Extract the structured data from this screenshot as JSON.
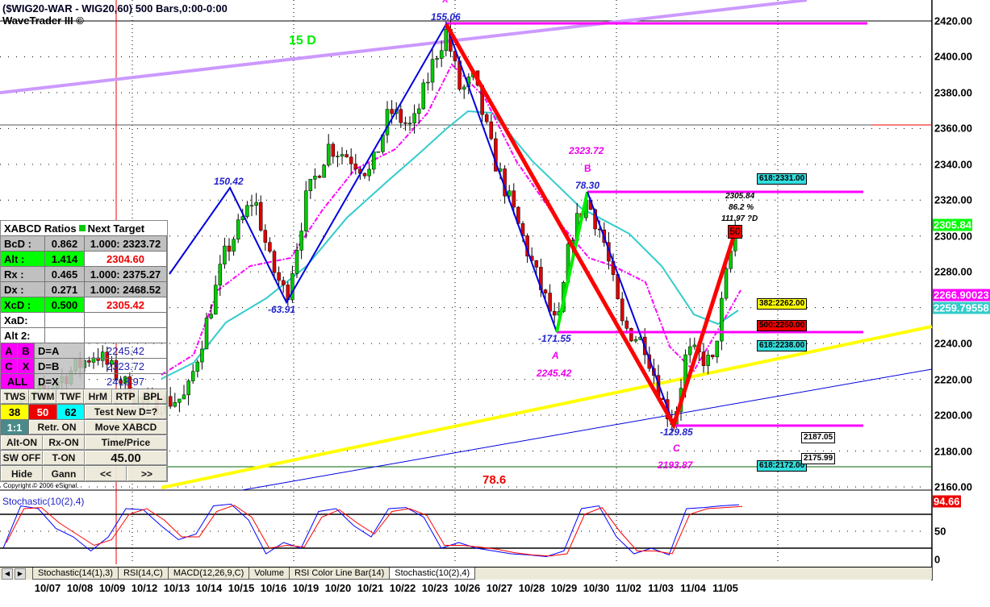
{
  "header": {
    "title": "($WIG20-WAR - WIG20,60) 500 Bars,0:00-0:00",
    "subtitle": "WaveTrader III ©",
    "copyright": "Copyright © 2006 eSignal."
  },
  "colors": {
    "up": "#00cc00",
    "down": "#dd0000",
    "pattern": "#ff0000",
    "zigzag": "#0000dd",
    "ma_fast": "#ff00ff",
    "ma_slow": "#33cccc",
    "trend_yellow": "#ffff00",
    "trend_purple": "#cc99ff",
    "level": "#ff00ff"
  },
  "annotations": {
    "x_label": "X",
    "x_value": "155.06",
    "wave_label": "15 D",
    "p1": "150.42",
    "p2": "-63.91",
    "b_price": "2323.72",
    "b_label": "B",
    "b_value": "78.30",
    "a_value": "-171.55",
    "a_label": "A",
    "a_price": "2245.42",
    "c_value": "-129.85",
    "c_label": "C",
    "c_price": "2193.87",
    "ratio": "78.6",
    "d_price": "2305.84",
    "d_pct": "86.2 %",
    "d_points": "111.97 ?D",
    "d_marker": "50"
  },
  "fib_boxes": [
    {
      "text": "618:2331.00",
      "color": "#33dddd"
    },
    {
      "text": "382:2262.00",
      "color": "#ffff00"
    },
    {
      "text": "500:2250.00",
      "color": "#ee0000"
    },
    {
      "text": "618:2238.00",
      "color": "#33dddd"
    },
    {
      "text": "618:2172.00",
      "color": "#33dddd"
    },
    {
      "text": "2187.05",
      "color": "#ffffff"
    },
    {
      "text": "2175.99",
      "color": "#ffffff"
    }
  ],
  "price_tags": [
    {
      "text": "2305.84",
      "color": "#00ff00",
      "fg": "#fff"
    },
    {
      "text": "2266.90023",
      "color": "#ff00ff",
      "fg": "#fff"
    },
    {
      "text": "2259.79558",
      "color": "#33cccc",
      "fg": "#fff"
    }
  ],
  "panel": {
    "header": "XABCD Ratios",
    "next_target": "Next Target",
    "ratios": [
      {
        "name": "BcD :",
        "value": "0.862",
        "target": "1.000: 2323.72",
        "style": "gray"
      },
      {
        "name": "Alt   :",
        "value": "1.414",
        "target": "2304.60",
        "style": "green"
      },
      {
        "name": "Rx    :",
        "value": "0.465",
        "target": "1.000: 2375.27",
        "style": "gray"
      },
      {
        "name": "Dx    :",
        "value": "0.271",
        "target": "1.000: 2468.52",
        "style": "gray"
      },
      {
        "name": "XcD :",
        "value": "0.500",
        "target": "2305.42",
        "style": "green"
      },
      {
        "name": "XaD:",
        "value": "",
        "target": "",
        "style": "white"
      },
      {
        "name": "Alt 2:",
        "value": "",
        "target": "",
        "style": "white"
      }
    ],
    "points": [
      {
        "b1": "A",
        "b2": "B",
        "label": "D=A",
        "value": "2245.42"
      },
      {
        "b1": "C",
        "b2": "X",
        "label": "D=B",
        "value": "2323.72"
      },
      {
        "b1": "ALL",
        "b2": "",
        "label": "D=X",
        "value": "2418.97"
      }
    ],
    "buttons_row1": [
      "TWS",
      "TWM",
      "TWF",
      "HrM",
      "RTP",
      "BPL"
    ],
    "fib_buttons": [
      "38",
      "50",
      "62"
    ],
    "test_new": "Test New D=?",
    "one_one": "1:1",
    "retr": "Retr. ON",
    "move": "Move XABCD",
    "alt_on": "Alt-ON",
    "rx_on": "Rx-ON",
    "time_price": "Time/Price",
    "sw_off": "SW OFF",
    "t_on": "T-ON",
    "value": "45.00",
    "hide": "Hide",
    "gann": "Gann",
    "prev": "<<",
    "next": ">>"
  },
  "indicator": {
    "title": "Stochastic(10(2),4)",
    "last": "94.66",
    "levels": [
      "50",
      "0"
    ]
  },
  "tabs": [
    "Stochastic(14(1),3)",
    "RSI(14,C)",
    "MACD(12,26,9,C)",
    "Volume",
    "RSI Color Line Bar(14)",
    "Stochastic(10(2),4)"
  ],
  "chart_data": {
    "type": "candlestick",
    "symbol": "$WIG20-WAR",
    "interval": "60",
    "bars": 500,
    "y_ticks": [
      "2420.00",
      "2400.00",
      "2380.00",
      "2360.00",
      "2340.00",
      "2320.00",
      "2300.00",
      "2280.00",
      "2260.00",
      "2240.00",
      "2220.00",
      "2200.00",
      "2180.00",
      "2160.00"
    ],
    "ylim": [
      2160,
      2420
    ],
    "x_ticks": [
      "10/07",
      "10/08",
      "10/09",
      "10/12",
      "10/13",
      "10/14",
      "10/15",
      "10/16",
      "10/19",
      "10/20",
      "10/21",
      "10/22",
      "10/23",
      "10/26",
      "10/27",
      "10/28",
      "10/29",
      "10/30",
      "11/02",
      "11/03",
      "11/04",
      "11/05"
    ],
    "price_path": [
      [
        -1.5,
        2195
      ],
      [
        0,
        2215
      ],
      [
        1.5,
        2235
      ],
      [
        3,
        2205
      ],
      [
        4.3,
        2210
      ],
      [
        5.5,
        2290
      ],
      [
        6.4,
        2322
      ],
      [
        6.9,
        2285
      ],
      [
        7.4,
        2266
      ],
      [
        8,
        2320
      ],
      [
        8.7,
        2350
      ],
      [
        9.3,
        2345
      ],
      [
        10,
        2335
      ],
      [
        10.6,
        2370
      ],
      [
        11.3,
        2360
      ],
      [
        12,
        2400
      ],
      [
        12.35,
        2414
      ],
      [
        12.8,
        2380
      ],
      [
        13.2,
        2388
      ],
      [
        13.8,
        2345
      ],
      [
        14.5,
        2310
      ],
      [
        15.2,
        2275
      ],
      [
        15.8,
        2247
      ],
      [
        16.2,
        2300
      ],
      [
        16.7,
        2320
      ],
      [
        17.2,
        2300
      ],
      [
        17.8,
        2250
      ],
      [
        18.5,
        2240
      ],
      [
        19.1,
        2205
      ],
      [
        19.4,
        2196
      ],
      [
        19.8,
        2235
      ],
      [
        20.3,
        2232
      ],
      [
        20.6,
        2228
      ],
      [
        21,
        2275
      ],
      [
        21.3,
        2304
      ]
    ],
    "stochastic": {
      "k": [
        20,
        95,
        90,
        55,
        40,
        15,
        40,
        90,
        88,
        60,
        35,
        45,
        95,
        98,
        70,
        10,
        30,
        20,
        85,
        90,
        60,
        40,
        90,
        92,
        75,
        20,
        30,
        20,
        15,
        10,
        8,
        5,
        15,
        90,
        95,
        40,
        10,
        20,
        8,
        90,
        92,
        95,
        97
      ],
      "d": [
        30,
        90,
        92,
        65,
        45,
        25,
        35,
        80,
        90,
        70,
        40,
        40,
        85,
        96,
        75,
        20,
        25,
        22,
        75,
        88,
        65,
        45,
        85,
        90,
        78,
        25,
        25,
        22,
        18,
        12,
        8,
        6,
        10,
        80,
        92,
        50,
        15,
        15,
        10,
        80,
        90,
        92,
        94
      ]
    }
  }
}
